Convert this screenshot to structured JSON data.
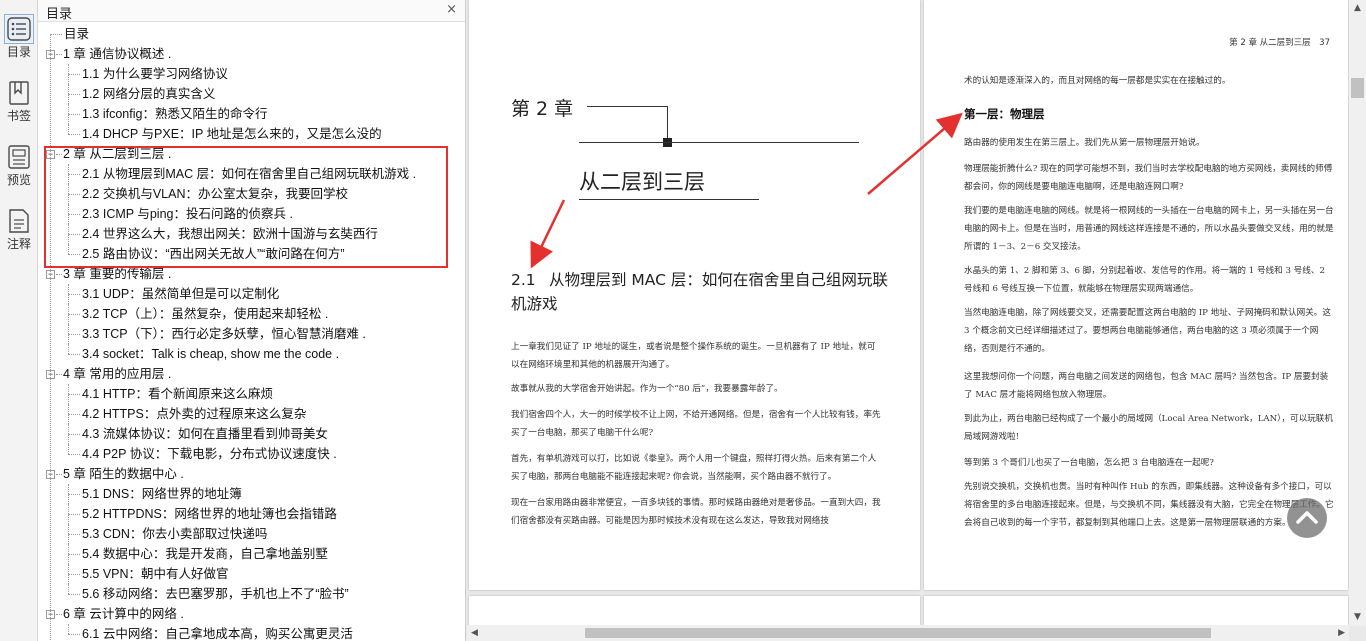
{
  "rail": [
    {
      "label": "目录",
      "icon": "toc-icon"
    },
    {
      "label": "书签",
      "icon": "bookmark-icon"
    },
    {
      "label": "预览",
      "icon": "preview-icon"
    },
    {
      "label": "注释",
      "icon": "annotation-icon"
    }
  ],
  "toc": {
    "title": "目录",
    "close": "×",
    "items": [
      {
        "text": "目录",
        "level": 0
      },
      {
        "text": "1 章 通信协议概述 .",
        "level": 1
      },
      {
        "text": "1.1 为什么要学习网络协议",
        "level": 2
      },
      {
        "text": "1.2 网络分层的真实含义",
        "level": 2
      },
      {
        "text": "1.3 ifconfig：熟悉又陌生的命令行",
        "level": 2
      },
      {
        "text": "1.4 DHCP 与PXE：IP 地址是怎么来的，又是怎么没的",
        "level": 2
      },
      {
        "text": "2 章 从二层到三层 .",
        "level": 1
      },
      {
        "text": "2.1 从物理层到MAC 层：如何在宿舍里自己组网玩联机游戏 .",
        "level": 2
      },
      {
        "text": "2.2 交换机与VLAN：办公室太复杂，我要回学校",
        "level": 2
      },
      {
        "text": "2.3 ICMP 与ping：投石问路的侦察兵 .",
        "level": 2
      },
      {
        "text": "2.4 世界这么大，我想出网关：欧洲十国游与玄奘西行",
        "level": 2
      },
      {
        "text": "2.5 路由协议：“西出网关无故人”“敢问路在何方”",
        "level": 2
      },
      {
        "text": "3 章 重要的传输层 .",
        "level": 1
      },
      {
        "text": "3.1 UDP：虽然简单但是可以定制化",
        "level": 2
      },
      {
        "text": "3.2 TCP（上）：虽然复杂，使用起来却轻松 .",
        "level": 2
      },
      {
        "text": "3.3 TCP（下）：西行必定多妖孽，恒心智慧消磨难 .",
        "level": 2
      },
      {
        "text": "3.4 socket：Talk is cheap, show me the code .",
        "level": 2
      },
      {
        "text": "4 章 常用的应用层 .",
        "level": 1
      },
      {
        "text": "4.1 HTTP：看个新闻原来这么麻烦",
        "level": 2
      },
      {
        "text": "4.2 HTTPS：点外卖的过程原来这么复杂",
        "level": 2
      },
      {
        "text": "4.3 流媒体协议：如何在直播里看到帅哥美女",
        "level": 2
      },
      {
        "text": "4.4 P2P 协议：下载电影，分布式协议速度快 .",
        "level": 2
      },
      {
        "text": "5 章 陌生的数据中心 .",
        "level": 1
      },
      {
        "text": "5.1 DNS：网络世界的地址簿",
        "level": 2
      },
      {
        "text": "5.2 HTTPDNS：网络世界的地址簿也会指错路",
        "level": 2
      },
      {
        "text": "5.3 CDN：你去小卖部取过快递吗",
        "level": 2
      },
      {
        "text": "5.4 数据中心：我是开发商，自己拿地盖别墅",
        "level": 2
      },
      {
        "text": "5.5 VPN：朝中有人好做官",
        "level": 2
      },
      {
        "text": "5.6 移动网络：去巴塞罗那，手机也上不了“脸书”",
        "level": 2
      },
      {
        "text": "6 章 云计算中的网络 .",
        "level": 1
      },
      {
        "text": "6.1 云中网络：自己拿地成本高，购买公寓更灵活",
        "level": 2
      }
    ]
  },
  "left_page": {
    "chapter_label": "第 2 章",
    "chapter_title": "从二层到三层",
    "section_num": "2.1",
    "section_title": "从物理层到 MAC 层：如何在宿舍里自己组网玩联机游戏",
    "paragraphs": [
      "上一章我们见证了 IP 地址的诞生，或者说是整个操作系统的诞生。一旦机器有了 IP 地址，就可以在网络环境里和其他的机器展开沟通了。",
      "故事就从我的大学宿舍开始讲起。作为一个“80 后”，我要暴露年龄了。",
      "我们宿舍四个人，大一的时候学校不让上网，不给开通网络。但是，宿舍有一个人比较有钱，率先买了一台电脑，那买了电脑干什么呢?",
      "首先，有单机游戏可以打，比如说《拳皇》。两个人用一个键盘，照样打得火热。后来有第二个人买了电脑，那两台电脑能不能连接起来呢? 你会说，当然能啊，买个路由器不就行了。",
      "现在一台家用路由器非常便宜，一百多块钱的事情。那时候路由器绝对是奢侈品。一直到大四，我们宿舍都没有买路由器。可能是因为那时候技术没有现在这么发达，导致我对网络技"
    ]
  },
  "right_page": {
    "running_head": "第 2 章 从二层到三层　37",
    "first_line": "术的认知是逐渐深入的，而且对网络的每一层都是实实在在接触过的。",
    "heading": "第一层：物理层",
    "paragraphs": [
      "路由器的使用发生在第三层上。我们先从第一层物理层开始说。",
      "物理层能折腾什么? 现在的同学可能想不到，我们当时去学校配电脑的地方买网线，卖网线的师傅都会问，你的网线是要电脑连电脑啊，还是电脑连网口啊?",
      "我们要的是电脑连电脑的网线。就是将一根网线的一头插在一台电脑的网卡上，另一头插在另一台电脑的网卡上。但是在当时，用普通的网线这样连接是不通的，所以水晶头要做交叉线，用的就是所谓的 1－3、2－6 交叉接法。",
      "水晶头的第 1、2 脚和第 3、6 脚，分别起着收、发信号的作用。将一端的 1 号线和 3 号线、2 号线和 6 号线互换一下位置，就能够在物理层实现两端通信。",
      "当然电脑连电脑，除了网线要交叉，还需要配置这两台电脑的 IP 地址、子网掩码和默认网关。这 3 个概念前文已经详细描述过了。要想两台电脑能够通信，两台电脑的这 3 项必须属于一个网络，否则是行不通的。",
      "这里我想问你一个问题，两台电脑之间发送的网络包，包含 MAC 层吗? 当然包含。IP 层要封装了 MAC 层才能将网络包放入物理层。",
      "到此为止，两台电脑已经构成了一个最小的局域网（Local Area Network，LAN），可以玩联机局域网游戏啦!",
      "等到第 3 个哥们儿也买了一台电脑，怎么把 3 台电脑连在一起呢?",
      "先别说交换机，交换机也贵。当时有种叫作 Hub 的东西，即集线器。这种设备有多个接口，可以将宿舍里的多台电脑连接起来。但是，与交换机不同，集线器没有大脑，它完全在物理层工作。它会将自己收到的每一个字节，都复制到其他端口上去。这是第一层物理层联通的方案。"
    ]
  },
  "colors": {
    "highlight_box": "#e53030",
    "arrow": "#e53030"
  }
}
